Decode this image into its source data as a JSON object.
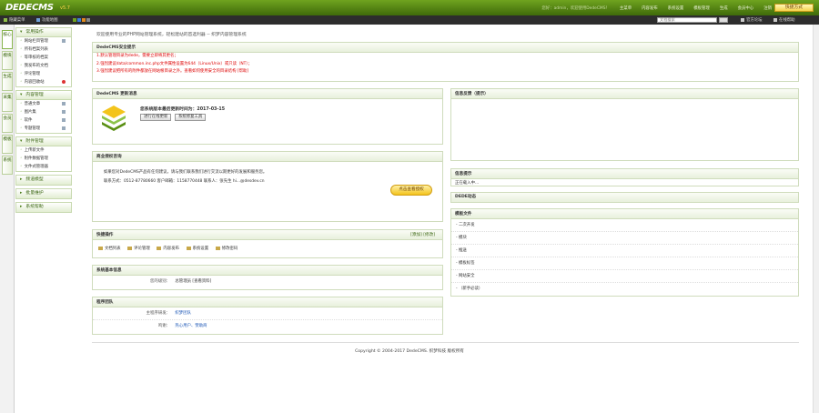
{
  "header": {
    "logo": "DEDECMS",
    "version": "v5.7",
    "nav": [
      "您好：admin，欢迎使用DedeCMS！",
      "主菜单",
      "内容发布",
      "系统设置",
      "模板管理",
      "生成",
      "会员中心",
      "注销"
    ],
    "nav_dim": "您好：admin，欢迎使用DedeCMS！",
    "quick_button": "快捷方式"
  },
  "subbar": {
    "hide_menu": "隐藏菜单",
    "function_map": "功能地图",
    "search_placeholder": "文档搜索",
    "official_forum": "官方论坛",
    "online_help": "在线帮助"
  },
  "vtabs": [
    "核心",
    "模块",
    "生成",
    "采集",
    "会员",
    "模板",
    "系统"
  ],
  "menu": {
    "groups": [
      {
        "title": "常用操作",
        "items": [
          "网站栏目管理",
          "所有档案列表",
          "等审核的档案",
          "我发布的文档",
          "评论管理",
          "内容回收站"
        ]
      },
      {
        "title": "内容管理",
        "items": [
          "普通文章",
          "图片集",
          "软件",
          "专题管理"
        ]
      },
      {
        "title": "附件管理",
        "items": [
          "上传新文件",
          "附件数据管理",
          "文件式管理器"
        ]
      },
      {
        "title": "频道模型"
      },
      {
        "title": "批量维护"
      },
      {
        "title": "系统帮助"
      }
    ]
  },
  "main": {
    "welcome": "欢迎使用专业的PHP网站管理系统，轻松建站的首选利器 -- 织梦内容管理系统",
    "security": {
      "title": "DedeCMS安全提示",
      "lines": [
        "1.默认管理目录为dede，需要立即将其更名；",
        "2.强烈建议data/common.inc.php文件属性设置为644（Linux/Unix）或只读（NT）；",
        "3.强烈建议把所有的附件都放在网站根目录之外。查看如何使用安全的目录结构 [帮助]"
      ]
    },
    "update": {
      "title": "DedeCMS 更新消息",
      "msg": "您系统版本最后更新时间为：2017-03-15",
      "btn_check": "进行在线更新",
      "btn_fix": "系统修复工具"
    },
    "dev_info": {
      "title": "信息反馈（提示）"
    },
    "business": {
      "title": "商业授权咨询",
      "line1": "如果您对DedeCMS产品有任何建议，请与我们联系我们进行交流以期更好的发展和服务您。",
      "line2": "联系方式：0512-87780660 客户邮箱：1158770448 联系人：张先生 hi...@desdev.cn",
      "cta": "点击查看授权"
    },
    "news": {
      "title": "信息提示",
      "text": "正在载入中..."
    },
    "dede_news": {
      "title": "DEDE动态"
    },
    "docs": {
      "title": "模板文件",
      "items": [
        "- 二次开发",
        "- 模块",
        "- 推送",
        "- 模板标签",
        "- 网站安全",
        "- （新手必读）"
      ]
    },
    "shortcuts": {
      "title": "快捷操作",
      "links": "[添加] [修改]",
      "items": [
        "文档列表",
        "评论管理",
        "内容发布",
        "系统设置",
        "修改密码"
      ]
    },
    "sysinfo": {
      "title": "系统基本信息",
      "label": "您的级别：",
      "value": "总管理员 [查看资料]"
    },
    "team": {
      "title": "程序团队",
      "r1_label": "主程序研发：",
      "r1_value": "织梦团队",
      "r2_label": "鸣谢：",
      "r2_value": "热心用户、赞助商"
    }
  },
  "footer": "Copyright © 2004-2017 DedeCMS. 织梦科技 版权所有",
  "colors": {
    "brand_green": "#5a8f14",
    "accent_orange": "#f3c41c",
    "link_blue": "#1a55b5",
    "warn_red": "#dd0000"
  }
}
